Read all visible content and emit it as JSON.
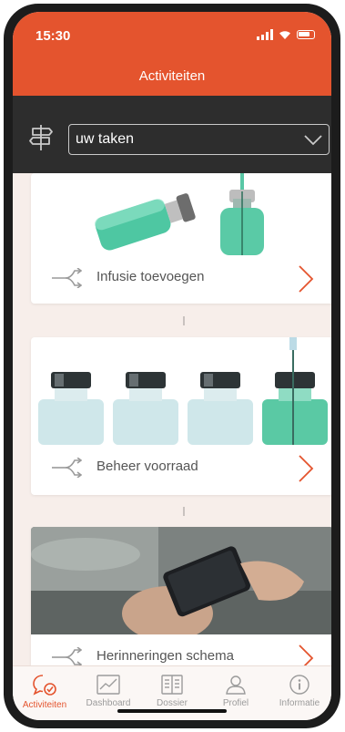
{
  "status": {
    "time": "15:30"
  },
  "header": {
    "title": "Activiteiten"
  },
  "filter": {
    "selected": "uw taken"
  },
  "cards": [
    {
      "label": "Infusie toevoegen"
    },
    {
      "label": "Beheer voorraad"
    },
    {
      "label": "Herinneringen schema"
    }
  ],
  "tabs": [
    {
      "label": "Activiteiten",
      "icon": "activity-bubble-icon",
      "active": true
    },
    {
      "label": "Dashboard",
      "icon": "chart-icon",
      "active": false
    },
    {
      "label": "Dossier",
      "icon": "book-icon",
      "active": false
    },
    {
      "label": "Profiel",
      "icon": "person-icon",
      "active": false
    },
    {
      "label": "Informatie",
      "icon": "info-icon",
      "active": false
    }
  ],
  "colors": {
    "brand": "#e4542e",
    "dark": "#2d2d2d",
    "background": "#f7eeea"
  }
}
